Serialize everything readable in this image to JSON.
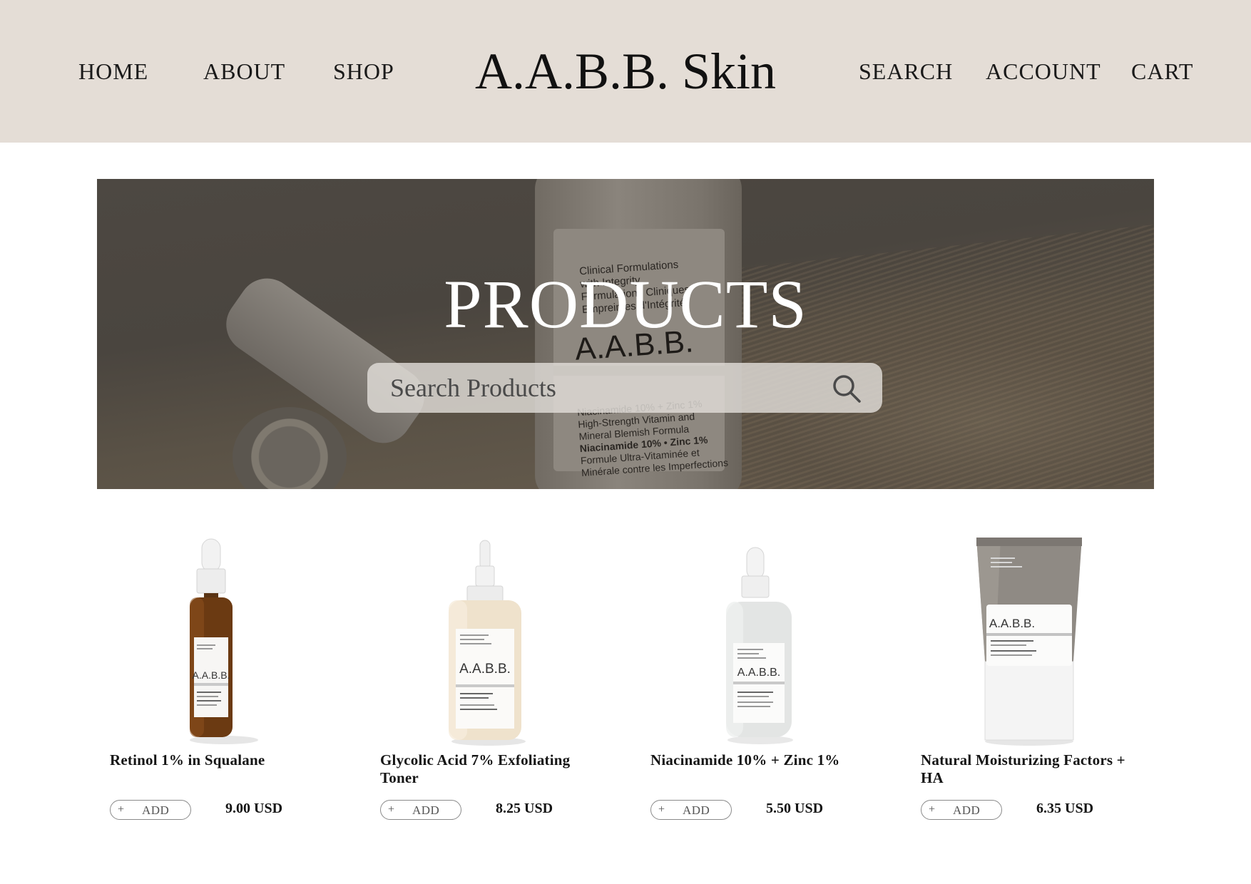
{
  "header": {
    "nav_left": [
      {
        "label": "HOME"
      },
      {
        "label": "ABOUT"
      },
      {
        "label": "SHOP"
      }
    ],
    "brand": "A.A.B.B. Skin",
    "nav_right": [
      {
        "label": "SEARCH"
      },
      {
        "label": "ACCOUNT"
      },
      {
        "label": "CART"
      }
    ],
    "background": "#e4ddd6"
  },
  "hero": {
    "title": "PRODUCTS",
    "bottle_text": {
      "line1": "Clinical Formulations",
      "line2": "with Integrity",
      "line3": "Formulations Cliniques",
      "line4": "Empreintes d'Intégrité.",
      "brand": "A.A.B.B.",
      "desc1": "Niacinamide 10% + Zinc 1%",
      "desc2": "High-Strength Vitamin and",
      "desc3": "Mineral Blemish Formula",
      "desc4": "Niacinamide 10% • Zinc 1%",
      "desc5": "Formule Ultra-Vitaminée et",
      "desc6": "Minérale contre les Imperfections"
    },
    "search": {
      "placeholder": "Search Products",
      "icon": "search-icon"
    }
  },
  "products": [
    {
      "name_line1": "Retinol 1% in Squalane",
      "name_line2": "",
      "add_label": "ADD",
      "add_icon": "plus-icon",
      "price": "9.00 USD",
      "label_brand": "A.A.B.B.",
      "bottle": "amber-dropper"
    },
    {
      "name_line1": "Glycolic Acid 7% Exfoliating",
      "name_line2": "Toner",
      "add_label": "ADD",
      "add_icon": "plus-icon",
      "price": "8.25 USD",
      "label_brand": "A.A.B.B.",
      "bottle": "toner-bottle"
    },
    {
      "name_line1": "Niacinamide 10% + Zinc 1%",
      "name_line2": "",
      "add_label": "ADD",
      "add_icon": "plus-icon",
      "price": "5.50 USD",
      "label_brand": "A.A.B.B.",
      "bottle": "frosted-dropper"
    },
    {
      "name_line1": "Natural Moisturizing Factors +",
      "name_line2": "HA",
      "add_label": "ADD",
      "add_icon": "plus-icon",
      "price": "6.35 USD",
      "label_brand": "A.A.B.B.",
      "bottle": "tube"
    }
  ]
}
